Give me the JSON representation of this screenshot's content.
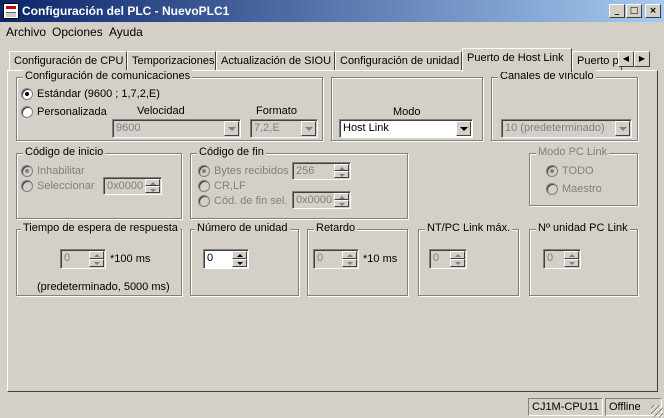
{
  "window": {
    "title": "Configuración del PLC - NuevoPLC1",
    "controls": {
      "minimize": "_",
      "maximize": "□",
      "close": "×"
    }
  },
  "menu": [
    "Archivo",
    "Opciones",
    "Ayuda"
  ],
  "tabs": [
    {
      "label": "Configuración de CPU"
    },
    {
      "label": "Temporizaciones"
    },
    {
      "label": "Actualización de SIOU"
    },
    {
      "label": "Configuración de unidad"
    },
    {
      "label": "Puerto de Host Link",
      "active": true
    },
    {
      "label": "Puerto p"
    }
  ],
  "tab_scroll": {
    "left": "◀",
    "right": "▶"
  },
  "comms": {
    "title": "Configuración de comunicaciones",
    "standard_label": "Estándar (9600 ; 1,7,2,E)",
    "standard_selected": true,
    "custom_label": "Personalizada",
    "custom_selected": false,
    "speed_label": "Velocidad",
    "speed_value": "9600",
    "format_label": "Formato",
    "format_value": "7,2,E"
  },
  "mode": {
    "label": "Modo",
    "value": "Host Link"
  },
  "link_channels": {
    "title": "Canales de vínculo",
    "value": "10 (predeterminado)"
  },
  "start_code": {
    "title": "Código de inicio",
    "disable_label": "Inhabilitar",
    "disable_selected": true,
    "select_label": "Seleccionar",
    "select_value": "0x0000"
  },
  "end_code": {
    "title": "Código de fin",
    "bytes_label": "Bytes recibidos",
    "bytes_selected": true,
    "bytes_value": "256",
    "crlf_label": "CR,LF",
    "sel_label": "Cód. de fin sel.",
    "sel_value": "0x0000"
  },
  "pc_link_mode": {
    "title": "Modo PC Link",
    "all_label": "TODO",
    "all_selected": true,
    "master_label": "Maestro"
  },
  "response_timeout": {
    "title": "Tiempo de espera de respuesta",
    "value": "0",
    "unit": "*100 ms",
    "note": "(predeterminado, 5000 ms)"
  },
  "unit_number": {
    "title": "Número de unidad",
    "value": "0"
  },
  "delay": {
    "title": "Retardo",
    "value": "0",
    "unit": "*10 ms"
  },
  "nt_pc_link_max": {
    "title": "NT/PC Link máx.",
    "value": "0"
  },
  "pc_link_unit_no": {
    "title": "Nº unidad PC Link",
    "value": "0"
  },
  "status": {
    "model": "CJ1M-CPU11",
    "state": "Offline"
  }
}
